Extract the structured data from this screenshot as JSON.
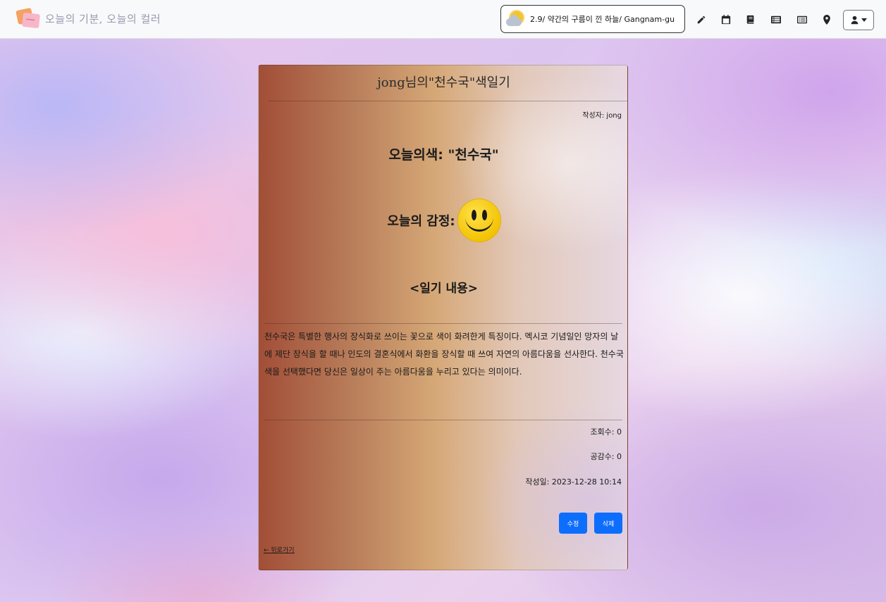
{
  "navbar": {
    "brand_text": "오늘의 기분, 오늘의 컬러",
    "weather_text": "2.9/ 약간의 구름이 낀 하늘/ Gangnam-gu",
    "icons": [
      "edit-icon",
      "calendar-icon",
      "book-icon",
      "list-icon",
      "list-alt-icon",
      "map-marker-icon",
      "user-icon"
    ]
  },
  "diary": {
    "title": "jong님의\"천수국\"색일기",
    "author": "작성자: jong",
    "color_line": "오늘의색: \"천수국\"",
    "emotion_label": "오늘의 감정:",
    "section_title": "<일기 내용>",
    "content": "천수국은 특별한 행사의 장식화로 쓰이는 꽃으로 색이 화려한게 특징이다. 멕시코 기념일인 망자의 날에 제단 장식을 할 때나 인도의 결혼식에서 화환을 장식할 때 쓰여 자연의 아름다움을 선사한다. 천수국 색을 선택했다면 당신은 일상이 주는 아름다움을 누리고 있다는 의미이다.",
    "views": "조회수: 0",
    "likes": "공감수: 0",
    "created": "작성일: 2023-12-28 10:14",
    "edit_label": "수정",
    "delete_label": "삭제",
    "back_label": "← 뒤로가기"
  },
  "colors": {
    "primary_button": "#0d6efd",
    "card_gradient_start": "#a24e37",
    "card_gradient_mid": "#d6a877"
  }
}
